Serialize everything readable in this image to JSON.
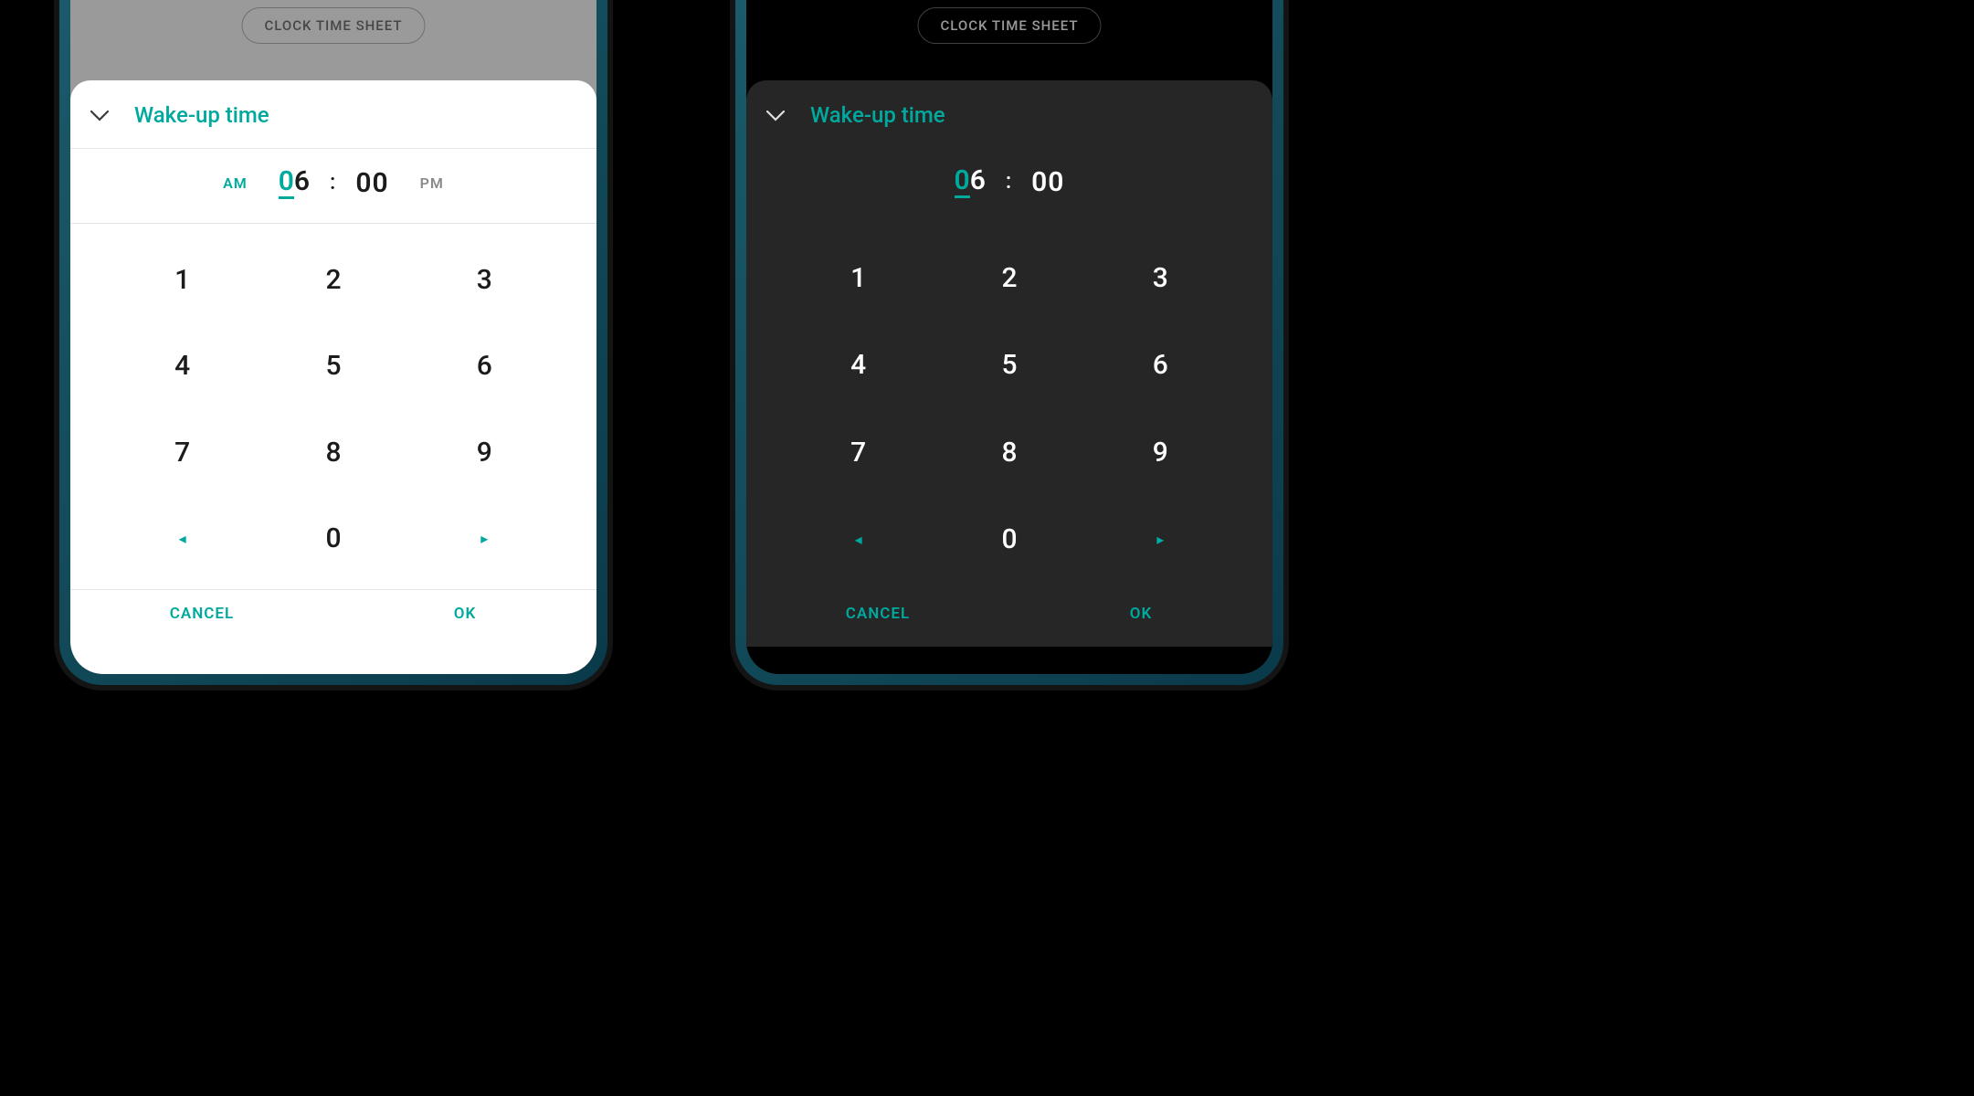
{
  "background_chip": "CLOCK TIME SHEET",
  "sheet": {
    "title": "Wake-up time",
    "am_label": "AM",
    "pm_label": "PM",
    "hour_cursor_digit": "0",
    "hour_next_digit": "6",
    "colon": ":",
    "minutes": "00"
  },
  "keypad": {
    "k1": "1",
    "k2": "2",
    "k3": "3",
    "k4": "4",
    "k5": "5",
    "k6": "6",
    "k7": "7",
    "k8": "8",
    "k9": "9",
    "k0": "0",
    "left_arrow": "◂",
    "right_arrow": "▸"
  },
  "footer": {
    "cancel": "CANCEL",
    "ok": "OK"
  },
  "colors": {
    "accent": "#00a99d"
  }
}
